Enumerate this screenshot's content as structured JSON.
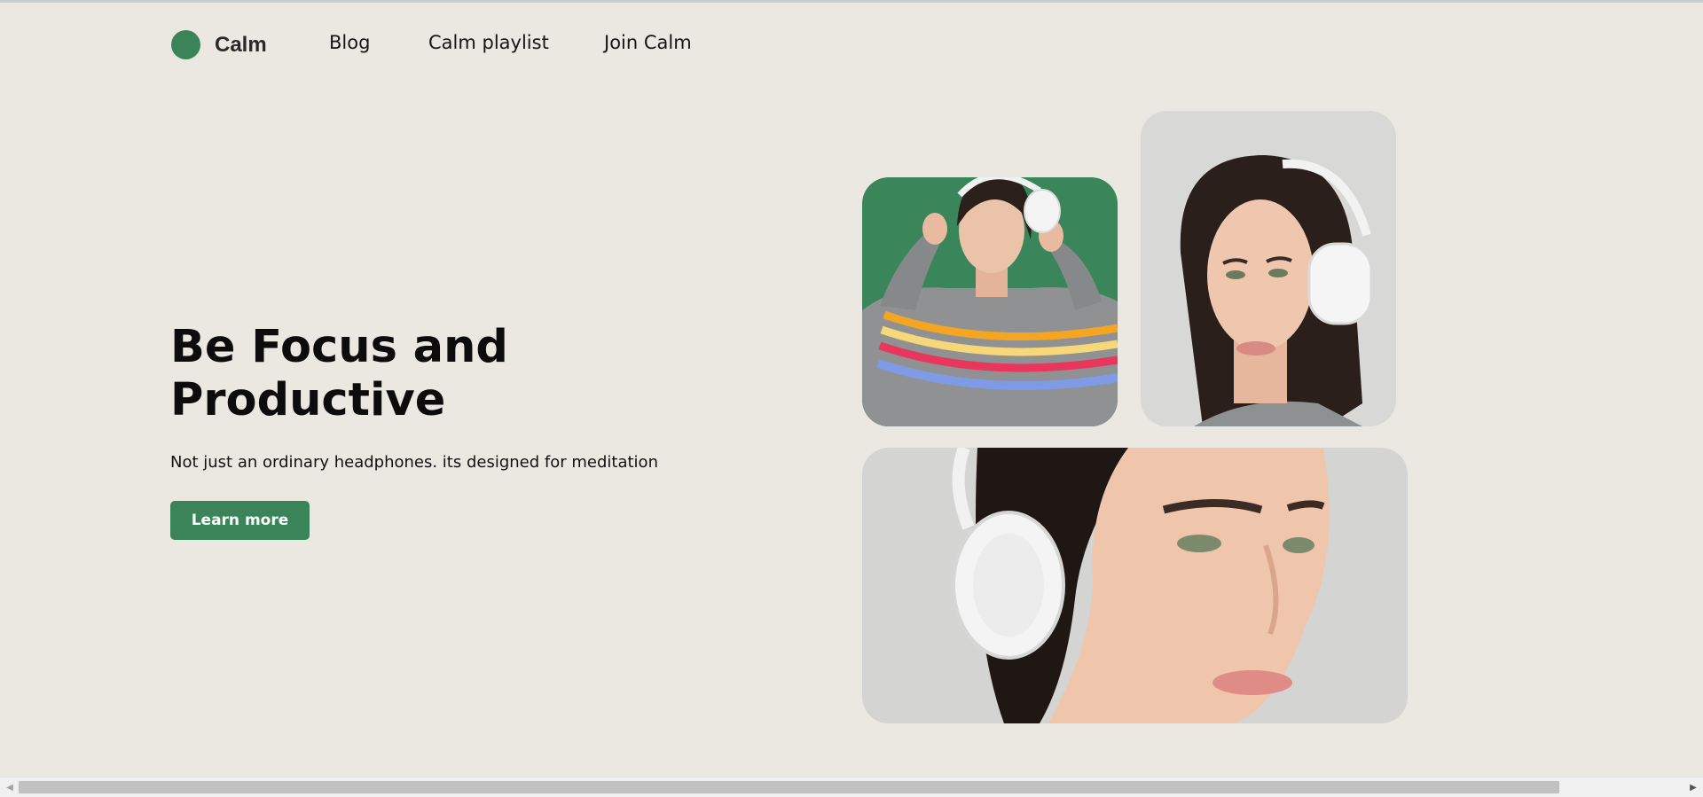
{
  "brand": {
    "name": "Calm",
    "color": "#3b8459"
  },
  "nav": {
    "items": [
      {
        "label": "Blog"
      },
      {
        "label": "Calm playlist"
      },
      {
        "label": "Join Calm"
      }
    ]
  },
  "hero": {
    "title_line1": "Be Focus and",
    "title_line2": "Productive",
    "subtitle": "Not just an ordinary headphones. its designed for meditation",
    "cta_label": "Learn more"
  },
  "gallery": [
    {
      "name": "woman-green-backdrop-photo",
      "background": "#3a8559"
    },
    {
      "name": "woman-portrait-photo",
      "background": "#d8d8d6"
    },
    {
      "name": "woman-closeup-photo",
      "background": "#d4d4d2"
    }
  ],
  "scrollbar": {
    "left_arrow": "◀",
    "right_arrow": "▶"
  }
}
